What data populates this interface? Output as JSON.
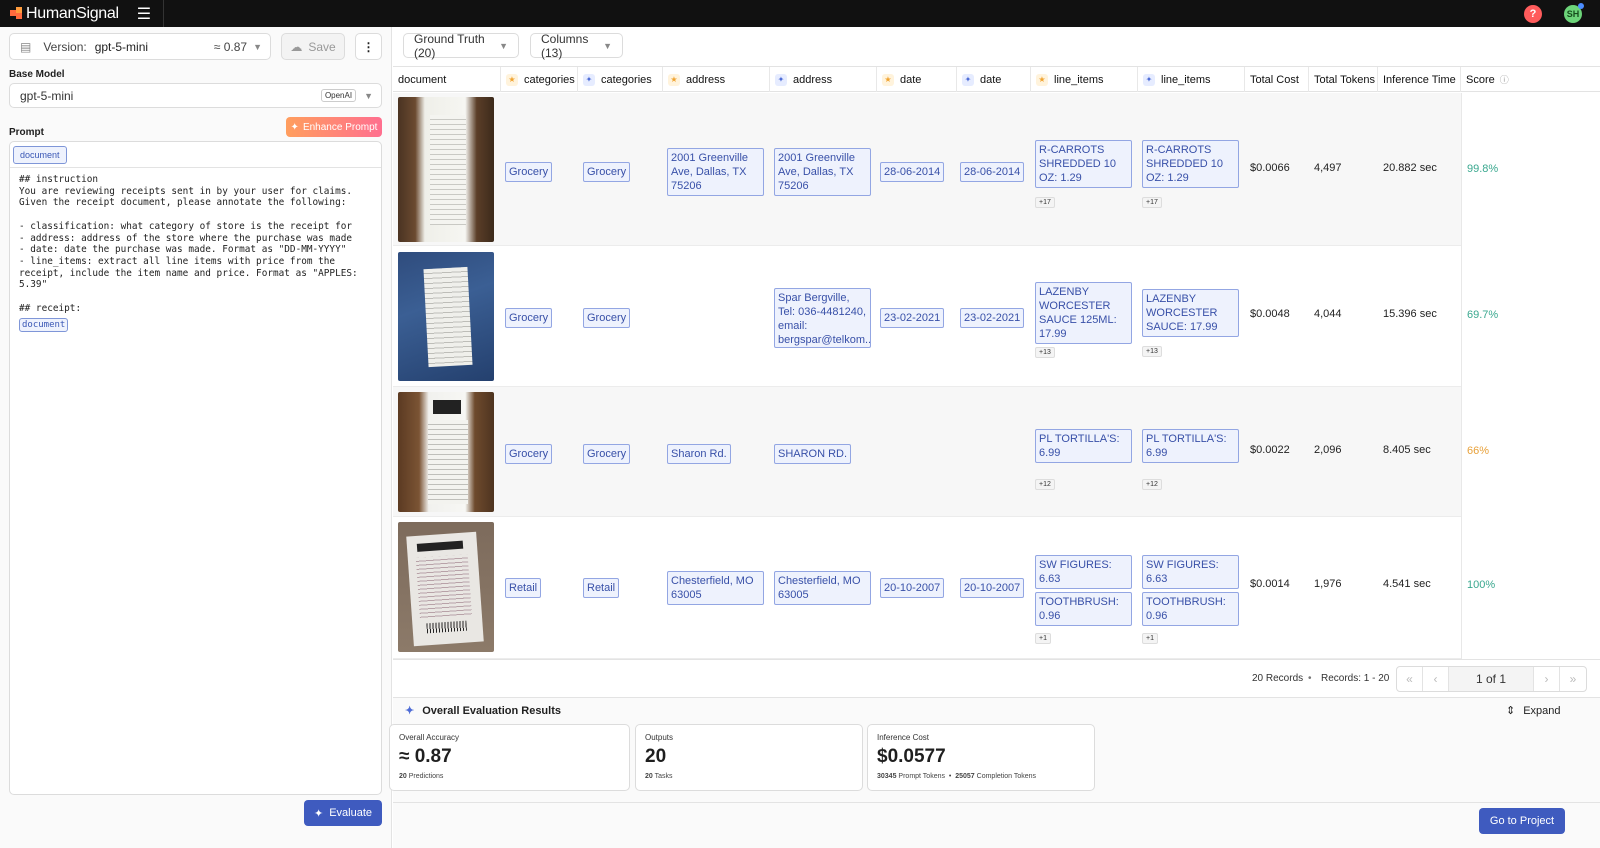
{
  "app": {
    "brand": "HumanSignal",
    "avatar_initials": "SH",
    "help_icon": "?"
  },
  "left": {
    "version_label": "Version:",
    "version_value": "gpt-5-mini",
    "version_score": "≈ 0.87",
    "save_label": "Save",
    "base_model_label": "Base Model",
    "base_model_value": "gpt-5-mini",
    "base_model_badge": "OpenAI",
    "prompt_label": "Prompt",
    "enhance_label": "Enhance Prompt",
    "prompt_chip": "document",
    "prompt_text": "## instruction\nYou are reviewing receipts sent in by your user for claims.\nGiven the receipt document, please annotate the following:\n\n- classification: what category of store is the receipt for\n- address: address of the store where the purchase was made\n- date: date the purchase was made. Format as \"DD-MM-YYYY\"\n- line_items: extract all line items with price from the\nreceipt, include the item name and price. Format as \"APPLES:\n5.39\"\n\n## receipt:",
    "prompt_inline_chip": "document",
    "evaluate_label": "Evaluate"
  },
  "toolbar": {
    "ground_truth_label": "Ground Truth (20)",
    "columns_label": "Columns (13)"
  },
  "table": {
    "headers": {
      "document": "document",
      "categories_gt": "categories",
      "categories_ai": "categories",
      "address_gt": "address",
      "address_ai": "address",
      "date_gt": "date",
      "date_ai": "date",
      "line_items_gt": "line_items",
      "line_items_ai": "line_items",
      "cost": "Total Cost",
      "tokens": "Total Tokens",
      "time": "Inference Time",
      "score": "Score"
    },
    "rows": [
      {
        "cat_gt": "Grocery",
        "cat_ai": "Grocery",
        "addr_gt": "2001 Greenville Ave, Dallas, TX 75206",
        "addr_ai": "2001 Greenville Ave, Dallas, TX 75206",
        "date_gt": "28-06-2014",
        "date_ai": "28-06-2014",
        "li_gt": "R-CARROTS SHREDDED 10 OZ: 1.29",
        "li_gt_more": "+17",
        "li_ai": "R-CARROTS SHREDDED 10 OZ: 1.29",
        "li_ai_more": "+17",
        "cost": "$0.0066",
        "tokens": "4,497",
        "time": "20.882 sec",
        "score": "99.8%",
        "score_color": "#3aa88f"
      },
      {
        "cat_gt": "Grocery",
        "cat_ai": "Grocery",
        "addr_gt": "",
        "addr_ai": "Spar Bergville, Tel: 036-4481240, email: bergspar@telkom...",
        "date_gt": "23-02-2021",
        "date_ai": "23-02-2021",
        "li_gt": "LAZENBY WORCESTER SAUCE 125ML: 17.99",
        "li_gt_more": "+13",
        "li_ai": "LAZENBY WORCESTER SAUCE: 17.99",
        "li_ai_more": "+13",
        "cost": "$0.0048",
        "tokens": "4,044",
        "time": "15.396 sec",
        "score": "69.7%",
        "score_color": "#3aa88f"
      },
      {
        "cat_gt": "Grocery",
        "cat_ai": "Grocery",
        "addr_gt": "Sharon Rd.",
        "addr_ai": "SHARON RD.",
        "date_gt": "",
        "date_ai": "",
        "li_gt": "PL TORTILLA'S: 6.99",
        "li_gt_more": "+12",
        "li_ai": "PL TORTILLA'S: 6.99",
        "li_ai_more": "+12",
        "cost": "$0.0022",
        "tokens": "2,096",
        "time": "8.405 sec",
        "score": "66%",
        "score_color": "#e8a13a"
      },
      {
        "cat_gt": "Retail",
        "cat_ai": "Retail",
        "addr_gt": "Chesterfield, MO 63005",
        "addr_ai": "Chesterfield, MO 63005",
        "date_gt": "20-10-2007",
        "date_ai": "20-10-2007",
        "li_gt": "SW FIGURES: 6.63",
        "li_gt2": "TOOTHBRUSH: 0.96",
        "li_gt_more": "+1",
        "li_ai": "SW FIGURES: 6.63",
        "li_ai2": "TOOTHBRUSH: 0.96",
        "li_ai_more": "+1",
        "cost": "$0.0014",
        "tokens": "1,976",
        "time": "4.541 sec",
        "score": "100%",
        "score_color": "#3aa88f"
      }
    ]
  },
  "pagination": {
    "records": "20 Records",
    "range": "Records: 1 - 20",
    "page": "1 of 1"
  },
  "evaluation": {
    "title": "Overall Evaluation Results",
    "expand_label": "Expand",
    "accuracy_title": "Overall Accuracy",
    "accuracy_value": "≈ 0.87",
    "accuracy_count": "20",
    "accuracy_sub": "Predictions",
    "outputs_title": "Outputs",
    "outputs_value": "20",
    "outputs_count": "20",
    "outputs_sub": "Tasks",
    "cost_title": "Inference Cost",
    "cost_value": "$0.0577",
    "prompt_tokens": "30345",
    "prompt_tokens_label": "Prompt Tokens",
    "completion_tokens": "25057",
    "completion_tokens_label": "Completion Tokens"
  },
  "footer": {
    "go_to_project_label": "Go to Project"
  }
}
